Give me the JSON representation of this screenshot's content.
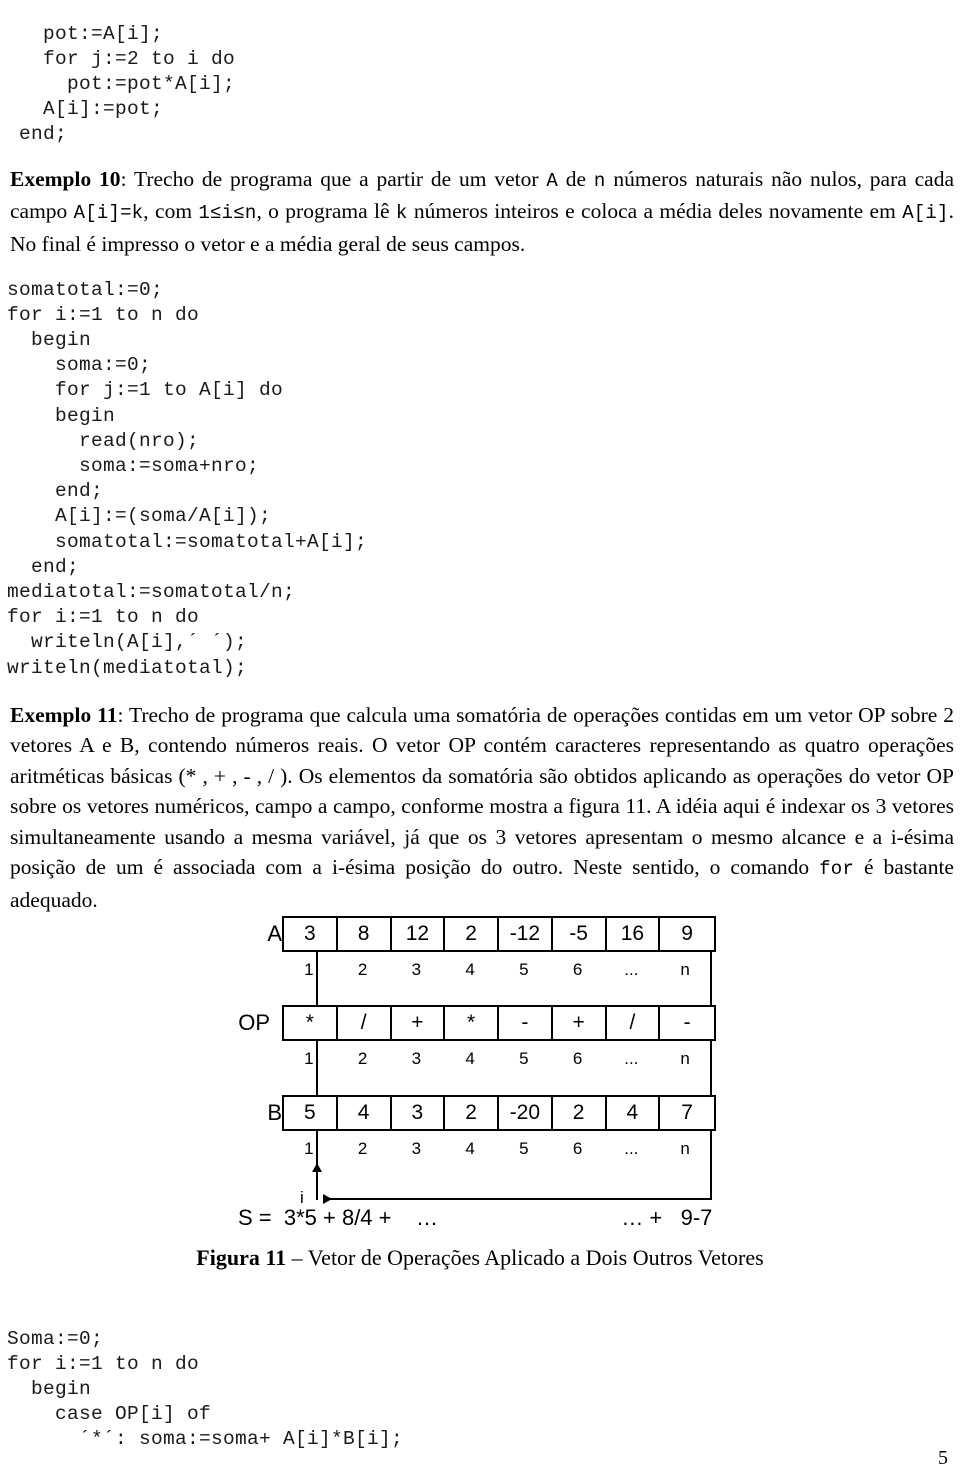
{
  "code_block_1": "   pot:=A[i];\n   for j:=2 to i do\n     pot:=pot*A[i];\n   A[i]:=pot;\n end;",
  "paragraph_exemplo_10": {
    "label": "Exemplo 10",
    "text_1": ": Trecho de programa que a partir de um vetor ",
    "mono_1": "A",
    "text_2": " de ",
    "mono_2": "n",
    "text_3": " números naturais não nulos, para cada campo ",
    "mono_3": "A[i]=k",
    "text_4": ", com ",
    "mono_4": "1≤i≤n",
    "text_5": ", o programa lê ",
    "mono_5": "k",
    "text_6": " números inteiros e coloca a média deles novamente em ",
    "mono_6": "A[i]",
    "text_7": ". No final é impresso o vetor e a média geral de seus campos."
  },
  "code_block_2": "somatotal:=0;\nfor i:=1 to n do\n  begin\n    soma:=0;\n    for j:=1 to A[i] do\n    begin\n      read(nro);\n      soma:=soma+nro;\n    end;\n    A[i]:=(soma/A[i]);\n    somatotal:=somatotal+A[i];\n  end;\nmediatotal:=somatotal/n;\nfor i:=1 to n do\n  writeln(A[i],´ ´);\nwriteln(mediatotal);",
  "paragraph_exemplo_11": {
    "label": "Exemplo 11",
    "text_1": ": Trecho de programa que calcula uma somatória de operações contidas em um vetor OP sobre 2 vetores A e B, contendo números reais. O vetor OP contém caracteres representando as quatro operações aritméticas básicas (* , + , - , / ). Os elementos da somatória são  obtidos aplicando as operações do vetor OP sobre os vetores numéricos, campo a campo, conforme mostra a figura 11. A idéia aqui é indexar os 3 vetores simultaneamente usando a mesma variável, já que os 3 vetores apresentam o mesmo alcance e a i-ésima posição de um é associada com a i-ésima posição do outro. Neste sentido, o comando ",
    "mono_1": "for",
    "text_2": " é bastante adequado."
  },
  "figure": {
    "rows": [
      {
        "label": "A",
        "values": [
          "3",
          "8",
          "12",
          "2",
          "-12",
          "-5",
          "16",
          "9"
        ],
        "indices": [
          "1",
          "2",
          "3",
          "4",
          "5",
          "6",
          "...",
          "n"
        ]
      },
      {
        "label": "OP",
        "values": [
          "*",
          "/",
          "+",
          "*",
          "-",
          "+",
          "/",
          "-"
        ],
        "indices": [
          "1",
          "2",
          "3",
          "4",
          "5",
          "6",
          "...",
          "n"
        ]
      },
      {
        "label": "B",
        "values": [
          "5",
          "4",
          "3",
          "2",
          "-20",
          "2",
          "4",
          "7"
        ],
        "indices": [
          "1",
          "2",
          "3",
          "4",
          "5",
          "6",
          "...",
          "n"
        ]
      }
    ],
    "index_marker": "i",
    "sum_line": "S =  3*5 + 8/4 +    …                              … +   9-7",
    "caption_label": "Figura 11",
    "caption_text": " – Vetor de Operações Aplicado a Dois Outros Vetores"
  },
  "code_block_3": "Soma:=0;\nfor i:=1 to n do\n  begin\n    case OP[i] of\n      ´*´: soma:=soma+ A[i]*B[i];",
  "page_number": "5"
}
